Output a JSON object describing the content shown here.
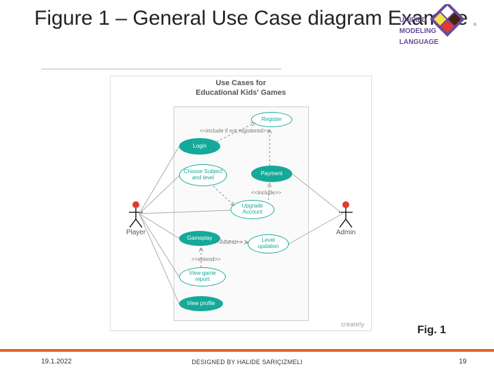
{
  "title": "Figure 1 – General Use Case diagram Example",
  "logo": {
    "line1": "UNIFIED",
    "line2": "MODELING",
    "line3": "LANGUAGE"
  },
  "diagram": {
    "header_l1": "Use Cases for",
    "header_l2": "Educational Kids' Games",
    "actors": {
      "left": "Player",
      "right": "Admin"
    },
    "usecases": {
      "register": "Register",
      "login": "Login",
      "choose": "Choose Subject and level",
      "payment": "Payment",
      "upgrade": "Upgrade Account",
      "gameplay": "Gameplay",
      "level": "Level updation",
      "report": "View game report",
      "profile": "View profile"
    },
    "stereotypes": {
      "include_not_reg": "<<include if not registered>>",
      "include": "<<include>>",
      "extend1": "<<extend>>",
      "extend2": "<<extend>>"
    },
    "watermark": "creately"
  },
  "caption": "Fig. 1",
  "footer": {
    "date": "19.1.2022",
    "author": "DESIGNED BY HALIDE SARIÇIZMELI",
    "page": "19"
  }
}
